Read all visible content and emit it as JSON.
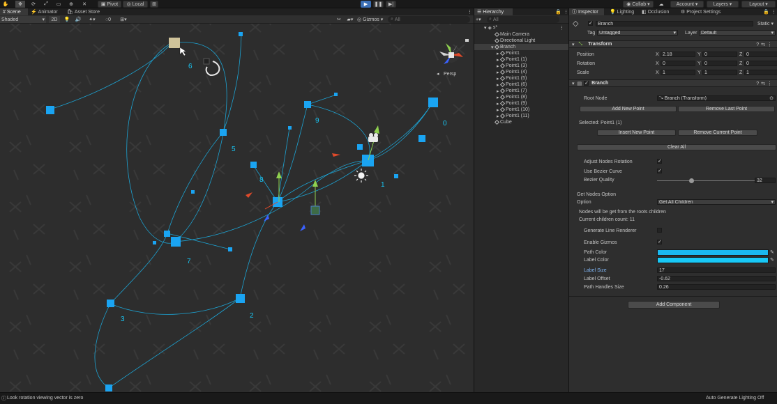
{
  "toolbar": {
    "pivot": "Pivot",
    "local": "Local",
    "collab": "Collab",
    "account": "Account",
    "layers": "Layers",
    "layout": "Layout"
  },
  "scene": {
    "tabs": [
      "Scene",
      "Animator",
      "Asset Store"
    ],
    "shading": "Shaded",
    "mode2d": "2D",
    "fx_count": "0",
    "gizmos": "Gizmos",
    "search_placeholder": "All",
    "persp": "Persp",
    "point_labels": [
      "0",
      "1",
      "2",
      "3",
      "5",
      "6",
      "7",
      "8",
      "9"
    ]
  },
  "hierarchy": {
    "title": "Hierarchy",
    "search_placeholder": "All",
    "scene_name": "s*",
    "items": [
      {
        "label": "Main Camera",
        "depth": 1
      },
      {
        "label": "Directional Light",
        "depth": 1
      },
      {
        "label": "Branch",
        "depth": 1,
        "selected": true
      },
      {
        "label": "Point1",
        "depth": 2
      },
      {
        "label": "Point1 (1)",
        "depth": 2
      },
      {
        "label": "Point1 (3)",
        "depth": 2
      },
      {
        "label": "Point1 (4)",
        "depth": 2
      },
      {
        "label": "Point1 (5)",
        "depth": 2
      },
      {
        "label": "Point1 (6)",
        "depth": 2
      },
      {
        "label": "Point1 (7)",
        "depth": 2
      },
      {
        "label": "Point1 (8)",
        "depth": 2
      },
      {
        "label": "Point1 (9)",
        "depth": 2
      },
      {
        "label": "Point1 (10)",
        "depth": 2
      },
      {
        "label": "Point1 (11)",
        "depth": 2
      },
      {
        "label": "Cube",
        "depth": 1
      }
    ]
  },
  "inspector": {
    "tabs": [
      "Inspector",
      "Lighting",
      "Occlusion",
      "Project Settings"
    ],
    "object_name": "Branch",
    "static_label": "Static",
    "tag_label": "Tag",
    "tag_value": "Untagged",
    "layer_label": "Layer",
    "layer_value": "Default",
    "transform": {
      "title": "Transform",
      "position_label": "Position",
      "rotation_label": "Rotation",
      "scale_label": "Scale",
      "position": [
        "2.18",
        "0",
        "0"
      ],
      "rotation": [
        "0",
        "0",
        "0"
      ],
      "scale": [
        "1",
        "1",
        "1"
      ]
    },
    "branch": {
      "title": "Branch",
      "root_node_label": "Root Node",
      "root_node_value": "Branch (Transform)",
      "add_new_point": "Add New Point",
      "remove_last_point": "Remove Last Point",
      "selected_label": "Selected: Point1 (1)",
      "insert_new_point": "Insert New Point",
      "remove_current_point": "Remove Current Point",
      "clear_all": "Clear All",
      "adjust_nodes_rotation": "Adjust Nodes Rotation",
      "use_bezier_curve": "Use Bezier Curve",
      "bezier_quality_label": "Bezier Quality",
      "bezier_quality_value": "32",
      "get_nodes_option": "Get Nodes Option",
      "option_label": "Option",
      "option_value": "Get All Children",
      "nodes_info": "Nodes will be get from the roots children",
      "children_count": "Current children count: 11",
      "generate_line_renderer": "Generate Line Renderer",
      "enable_gizmos": "Enable Gizmos",
      "path_color_label": "Path Color",
      "label_color_label": "Label Color",
      "label_size_label": "Label Size",
      "label_size_value": "17",
      "label_offset_label": "Label Offset",
      "label_offset_value": "-0.62",
      "path_handles_size_label": "Path Handles Size",
      "path_handles_size_value": "0.26",
      "add_component": "Add Component"
    }
  },
  "status": {
    "message": "Look rotation viewing vector is zero",
    "lighting": "Auto Generate Lighting Off"
  },
  "colors": {
    "path": "#1ab8f0",
    "label": "#18c8f6",
    "node": "#1aa4f2",
    "accent": "#3a7fcf"
  }
}
